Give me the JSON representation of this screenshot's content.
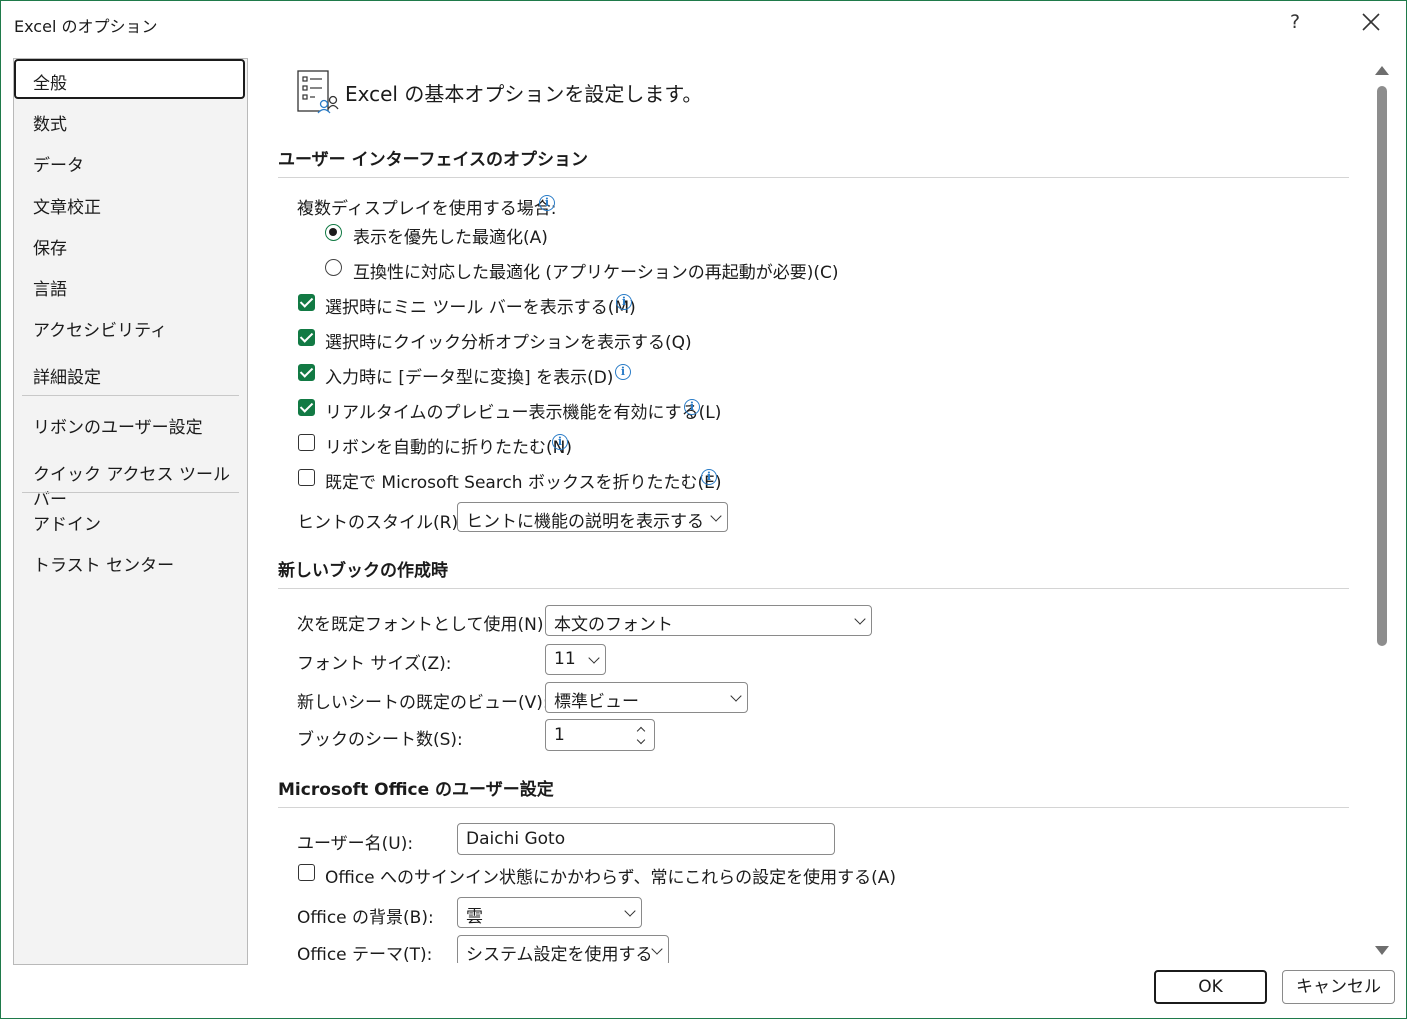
{
  "window": {
    "title": "Excel のオプション",
    "help_label": "?",
    "close_icon": "close-icon"
  },
  "nav": {
    "items": [
      {
        "label": "全般",
        "selected": true
      },
      {
        "label": "数式"
      },
      {
        "label": "データ"
      },
      {
        "label": "文章校正"
      },
      {
        "label": "保存"
      },
      {
        "label": "言語"
      },
      {
        "label": "アクセシビリティ"
      },
      {
        "label": "詳細設定"
      },
      {
        "label": "リボンのユーザー設定"
      },
      {
        "label": "クイック アクセス ツール バー"
      },
      {
        "label": "アドイン"
      },
      {
        "label": "トラスト センター"
      }
    ]
  },
  "header": {
    "icon": "general-options-icon",
    "text": "Excel の基本オプションを設定します。"
  },
  "ui_options": {
    "heading": "ユーザー インターフェイスのオプション",
    "multi_display_label": "複数ディスプレイを使用する場合:",
    "radio_display": "表示を優先した最適化(A)",
    "radio_compat": "互換性に対応した最適化 (アプリケーションの再起動が必要)(C)",
    "mini_toolbar": "選択時にミニ ツール バーを表示する(M)",
    "quick_analysis": "選択時にクイック分析オプションを表示する(Q)",
    "convert_datatype": "入力時に [データ型に変換] を表示(D)",
    "live_preview": "リアルタイムのプレビュー表示機能を有効にする(L)",
    "collapse_ribbon": "リボンを自動的に折りたたむ(N)",
    "collapse_search": "既定で Microsoft Search ボックスを折りたたむ(E)",
    "screentip_label": "ヒントのスタイル(R):",
    "screentip_value": "ヒントに機能の説明を表示する"
  },
  "new_workbook": {
    "heading": "新しいブックの作成時",
    "font_label": "次を既定フォントとして使用(N):",
    "font_value": "本文のフォント",
    "size_label": "フォント サイズ(Z):",
    "size_value": "11",
    "view_label": "新しいシートの既定のビュー(V):",
    "view_value": "標準ビュー",
    "sheets_label": "ブックのシート数(S):",
    "sheets_value": "1"
  },
  "office_settings": {
    "heading": "Microsoft Office のユーザー設定",
    "username_label": "ユーザー名(U):",
    "username_value": "Daichi Goto",
    "always_use": "Office へのサインイン状態にかかわらず、常にこれらの設定を使用する(A)",
    "background_label": "Office の背景(B):",
    "background_value": "雲",
    "theme_label": "Office テーマ(T):",
    "theme_value": "システム設定を使用する"
  },
  "footer": {
    "ok_label": "OK",
    "cancel_label": "キャンセル"
  }
}
